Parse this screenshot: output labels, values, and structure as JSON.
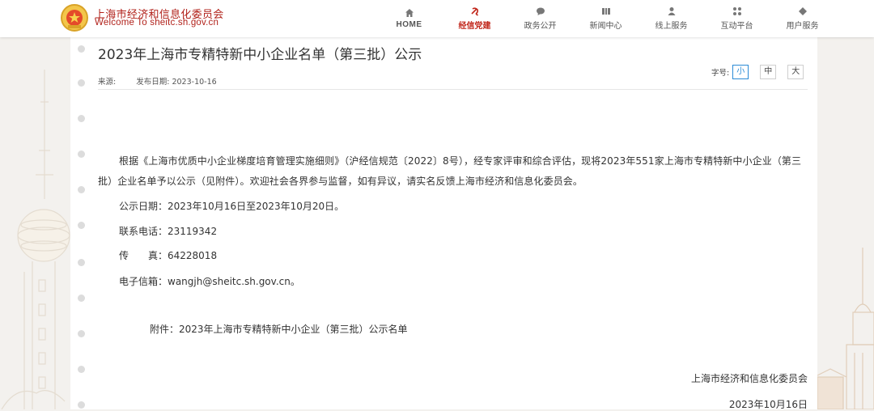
{
  "header": {
    "site_name": "上海市经济和信息化委员会",
    "site_sub": "Welcome To sheitc.sh.gov.cn",
    "nav": [
      {
        "label": "HOME",
        "icon": "home-icon"
      },
      {
        "label": "经信党建",
        "icon": "party-emblem-icon"
      },
      {
        "label": "政务公开",
        "icon": "chat-bubble-icon"
      },
      {
        "label": "新闻中心",
        "icon": "news-icon"
      },
      {
        "label": "线上服务",
        "icon": "user-service-icon"
      },
      {
        "label": "互动平台",
        "icon": "interaction-icon"
      },
      {
        "label": "用户服务",
        "icon": "diamond-icon"
      }
    ],
    "active_nav": "经信党建",
    "accent_color": "#c1261a"
  },
  "article": {
    "title": "2023年上海市专精特新中小企业名单（第三批）公示",
    "source_label": "来源:",
    "date_label": "发布日期:",
    "date_value": "2023-10-16",
    "font_size_label": "字号:",
    "font_sizes": [
      "小",
      "中",
      "大"
    ],
    "font_size_selected": "小",
    "body": "根据《上海市优质中小企业梯度培育管理实施细则》（沪经信规范〔2022〕8号），经专家评审和综合评估，现将2023年551家上海市专精特新中小企业（第三批）企业名单予以公示（见附件）。欢迎社会各界参与监督，如有异议，请实名反馈上海市经济和信息化委员会。",
    "notice_period": "公示日期：2023年10月16日至2023年10月20日。",
    "phone": "联系电话：23119342",
    "fax": "传　　真：64228018",
    "email": "电子信箱：wangjh@sheitc.sh.gov.cn。",
    "attachment_label": "附件：",
    "attachment_name": "2023年上海市专精特新中小企业（第三批）公示名单",
    "signature_org": "上海市经济和信息化委员会",
    "signature_date": "2023年10月16日"
  }
}
